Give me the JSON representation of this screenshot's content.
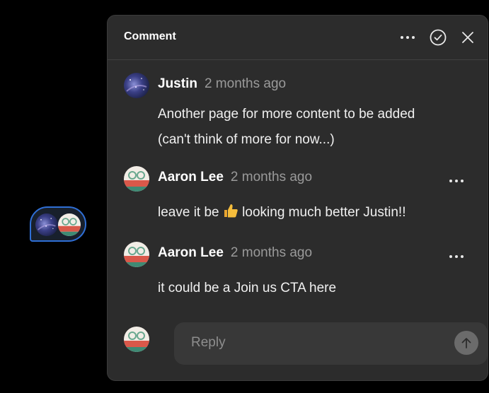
{
  "panel": {
    "title": "Comment"
  },
  "comments": [
    {
      "author": "Justin",
      "time": "2 months ago",
      "lines": [
        "Another page for more content to be added",
        "(can't think of more for now...)"
      ]
    },
    {
      "author": "Aaron Lee",
      "time": "2 months ago",
      "text_before": "leave it be ",
      "emoji_icon": "thumbs-up-icon",
      "text_after": " looking much better Justin!!"
    },
    {
      "author": "Aaron Lee",
      "time": "2 months ago",
      "text": "it could be a Join us CTA here"
    }
  ],
  "reply": {
    "placeholder": "Reply"
  },
  "colors": {
    "accent": "#2f6fd6",
    "panel_bg": "#2c2c2c",
    "muted": "#9a9a9a"
  }
}
